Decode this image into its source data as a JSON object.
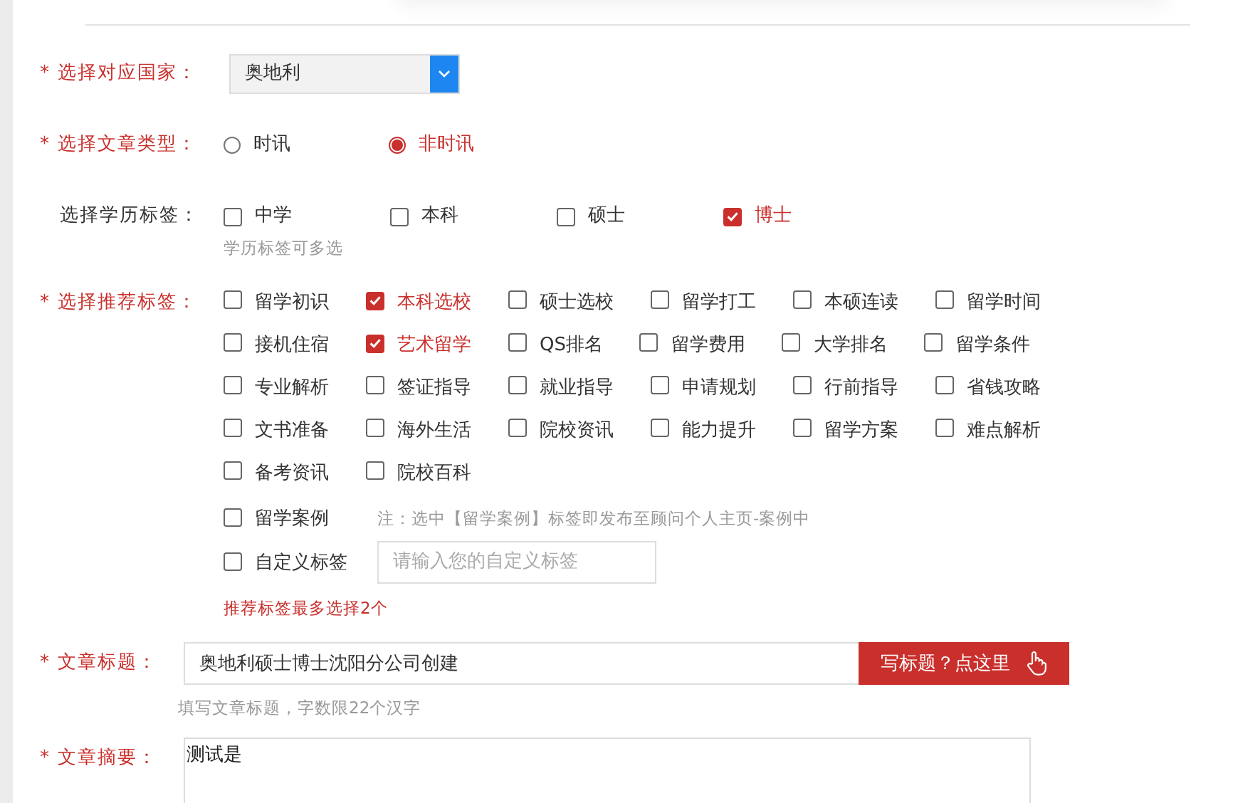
{
  "country": {
    "label": "* 选择对应国家：",
    "required": true,
    "value": "奥地利"
  },
  "article_type": {
    "label": "* 选择文章类型：",
    "required": true,
    "options": [
      {
        "label": "时讯",
        "selected": false
      },
      {
        "label": "非时讯",
        "selected": true
      }
    ]
  },
  "education": {
    "label": "选择学历标签：",
    "required": false,
    "hint": "学历标签可多选",
    "options": [
      {
        "label": "中学",
        "checked": false
      },
      {
        "label": "本科",
        "checked": false
      },
      {
        "label": "硕士",
        "checked": false
      },
      {
        "label": "博士",
        "checked": true
      }
    ]
  },
  "recommend": {
    "label": "* 选择推荐标签：",
    "required": true,
    "tags": [
      {
        "label": "留学初识",
        "checked": false
      },
      {
        "label": "本科选校",
        "checked": true
      },
      {
        "label": "硕士选校",
        "checked": false
      },
      {
        "label": "留学打工",
        "checked": false
      },
      {
        "label": "本硕连读",
        "checked": false
      },
      {
        "label": "留学时间",
        "checked": false
      },
      {
        "label": "接机住宿",
        "checked": false
      },
      {
        "label": "艺术留学",
        "checked": true
      },
      {
        "label": "QS排名",
        "checked": false
      },
      {
        "label": "留学费用",
        "checked": false
      },
      {
        "label": "大学排名",
        "checked": false
      },
      {
        "label": "留学条件",
        "checked": false
      },
      {
        "label": "专业解析",
        "checked": false
      },
      {
        "label": "签证指导",
        "checked": false
      },
      {
        "label": "就业指导",
        "checked": false
      },
      {
        "label": "申请规划",
        "checked": false
      },
      {
        "label": "行前指导",
        "checked": false
      },
      {
        "label": "省钱攻略",
        "checked": false
      },
      {
        "label": "文书准备",
        "checked": false
      },
      {
        "label": "海外生活",
        "checked": false
      },
      {
        "label": "院校资讯",
        "checked": false
      },
      {
        "label": "能力提升",
        "checked": false
      },
      {
        "label": "留学方案",
        "checked": false
      },
      {
        "label": "难点解析",
        "checked": false
      },
      {
        "label": "备考资讯",
        "checked": false
      },
      {
        "label": "院校百科",
        "checked": false
      }
    ],
    "case_tag": {
      "label": "留学案例",
      "checked": false,
      "note": "注：选中【留学案例】标签即发布至顾问个人主页-案例中"
    },
    "custom_tag": {
      "label": "自定义标签",
      "checked": false,
      "placeholder": "请输入您的自定义标签"
    },
    "warning": "推荐标签最多选择2个"
  },
  "title": {
    "label": "* 文章标题：",
    "required": true,
    "value": "奥地利硕士博士沈阳分公司创建",
    "button": "写标题？点这里",
    "hint": "填写文章标题，字数限22个汉字"
  },
  "summary": {
    "label": "* 文章摘要：",
    "required": true,
    "value": "测试是"
  }
}
